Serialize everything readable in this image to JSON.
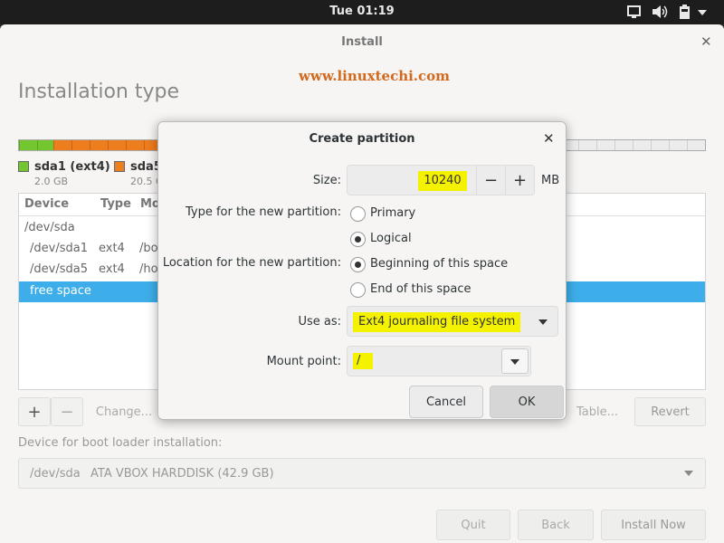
{
  "topbar": {
    "clock": "Tue 01:19",
    "tray_icons": [
      "display-icon",
      "volume-icon",
      "battery-icon",
      "menu-arrow-icon"
    ]
  },
  "window": {
    "title": "Install",
    "watermark": "www.linuxtechi.com",
    "page_title": "Installation type"
  },
  "partition_bar": {
    "colors": {
      "sda1": "#73c62d",
      "sda5": "#ee7d1e",
      "free": "#ececec"
    },
    "legend": [
      {
        "name": "sda1 (ext4)",
        "size": "2.0 GB"
      },
      {
        "name": "sda5",
        "size": "20.5 G"
      }
    ]
  },
  "table": {
    "headers": [
      "Device",
      "Type",
      "Mo"
    ],
    "rows": [
      {
        "device": "/dev/sda",
        "type": "",
        "mount": ""
      },
      {
        "device": "/dev/sda1",
        "type": "ext4",
        "mount": "/bo"
      },
      {
        "device": "/dev/sda5",
        "type": "ext4",
        "mount": "/ho"
      },
      {
        "device": "free space",
        "type": "",
        "mount": "",
        "selected": true
      }
    ],
    "selection_color": "#3daee9"
  },
  "toolbar": {
    "add_label": "+",
    "remove_label": "−",
    "change_label": "Change...",
    "new_table_label": "Table...",
    "revert_label": "Revert"
  },
  "boot": {
    "label": "Device for boot loader installation:",
    "device": "/dev/sda",
    "disk": "ATA VBOX HARDDISK (42.9 GB)"
  },
  "nav": {
    "quit": "Quit",
    "back": "Back",
    "install_now": "Install Now"
  },
  "dialog": {
    "title": "Create partition",
    "size_label": "Size:",
    "size_value": "10240",
    "size_minus": "−",
    "size_plus": "+",
    "size_unit": "MB",
    "type_label": "Type for the new partition:",
    "type_options": [
      {
        "label": "Primary",
        "checked": false
      },
      {
        "label": "Logical",
        "checked": true
      }
    ],
    "location_label": "Location for the new partition:",
    "location_options": [
      {
        "label": "Beginning of this space",
        "checked": true
      },
      {
        "label": "End of this space",
        "checked": false
      }
    ],
    "useas_label": "Use as:",
    "useas_value": "Ext4 journaling file system",
    "mount_label": "Mount point:",
    "mount_value": "/",
    "cancel_label": "Cancel",
    "ok_label": "OK",
    "highlight_color": "#f5f200"
  }
}
